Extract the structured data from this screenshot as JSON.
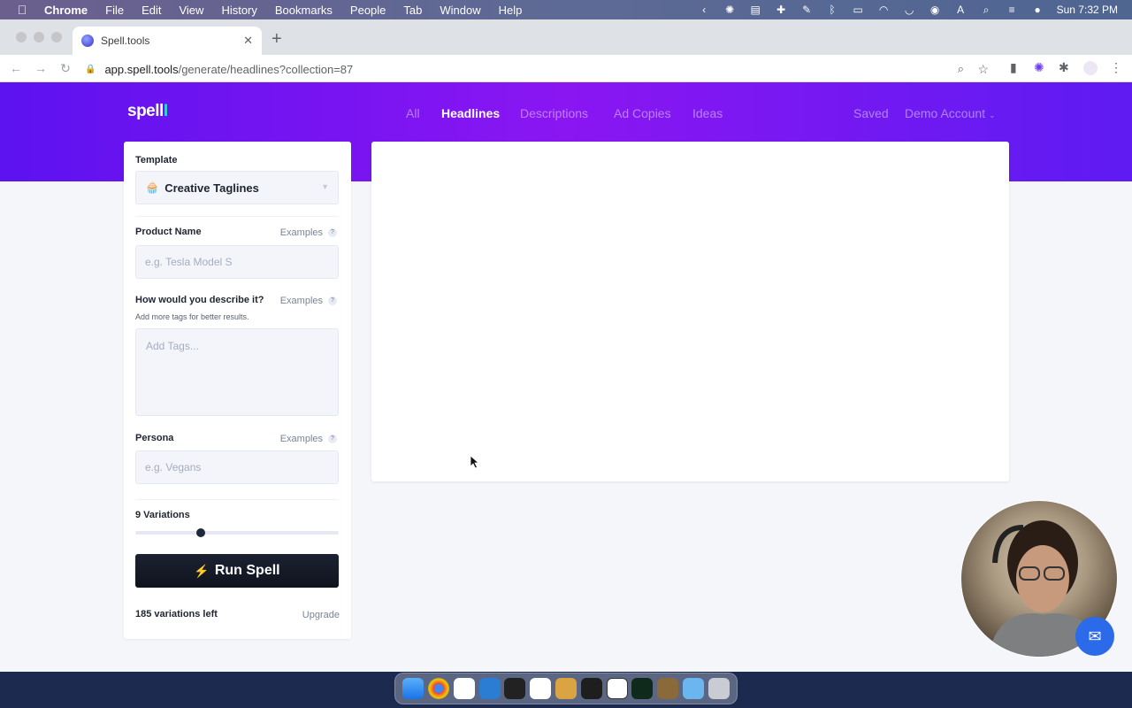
{
  "menubar": {
    "app": "Chrome",
    "items": [
      "File",
      "Edit",
      "View",
      "History",
      "Bookmarks",
      "People",
      "Tab",
      "Window",
      "Help"
    ],
    "clock": "Sun 7:32 PM"
  },
  "browser": {
    "tab_title": "Spell.tools",
    "url_host": "app.spell.tools",
    "url_path": "/generate/headlines?collection=87"
  },
  "app": {
    "logo": "spell",
    "logo_cursor": "I",
    "nav": {
      "all": "All",
      "headlines": "Headlines",
      "descriptions": "Descriptions",
      "ad_copies": "Ad Copies",
      "ideas": "Ideas"
    },
    "saved": "Saved",
    "account": "Demo Account"
  },
  "form": {
    "template_label": "Template",
    "template_value": "Creative Taglines",
    "template_emoji": "🧁",
    "product_label": "Product Name",
    "product_placeholder": "e.g. Tesla Model S",
    "describe_label": "How would you describe it?",
    "describe_hint": "Add more tags for better results.",
    "tags_placeholder": "Add Tags...",
    "persona_label": "Persona",
    "persona_placeholder": "e.g. Vegans",
    "examples": "Examples",
    "question_mark": "?",
    "variations_label": "9 Variations",
    "variations_value": 9,
    "variations_fraction": 0.32,
    "run_button": "Run Spell",
    "run_bolt": "⚡",
    "remaining": "185 variations left",
    "upgrade": "Upgrade"
  },
  "colors": {
    "hero_start": "#5d12f0",
    "hero_end": "#8a16f2",
    "run_button": "#141925",
    "logo_accent": "#23e2c0"
  },
  "icons": {
    "apple": "apple-icon",
    "chat": "chat-icon",
    "lock": "lock-icon"
  }
}
